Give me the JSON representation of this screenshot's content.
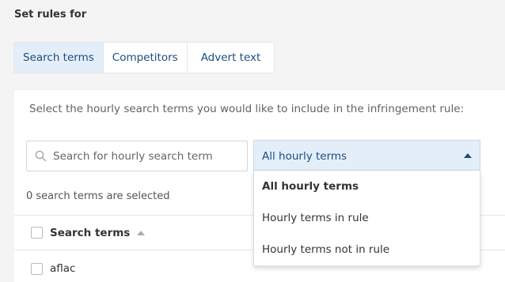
{
  "heading": "Set rules for",
  "tabs": [
    {
      "label": "Search terms",
      "active": true
    },
    {
      "label": "Competitors",
      "active": false
    },
    {
      "label": "Advert text",
      "active": false
    }
  ],
  "instruction": "Select the hourly search terms you would like to include in the infringement rule:",
  "search": {
    "placeholder": "Search for hourly search term",
    "value": ""
  },
  "filter": {
    "selected": "All hourly terms",
    "options": [
      "All hourly terms",
      "Hourly terms in rule",
      "Hourly terms not in rule"
    ]
  },
  "selected_count": "0 search terms are selected",
  "table": {
    "column": "Search terms",
    "rows": [
      "aflac"
    ]
  },
  "colors": {
    "accent": "#1b4d80",
    "active_bg": "#e4eef8"
  }
}
